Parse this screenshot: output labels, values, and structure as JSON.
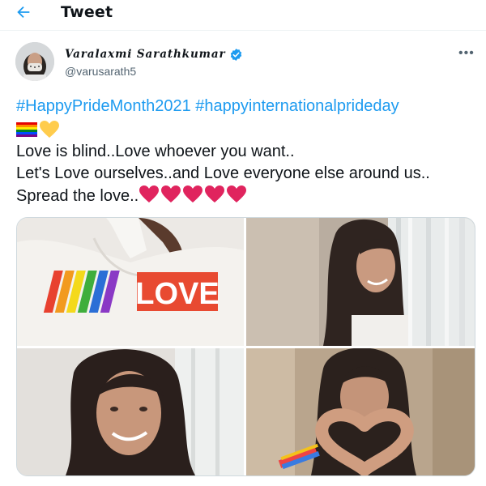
{
  "header": {
    "title": "Tweet"
  },
  "author": {
    "display_name": "Varalaxmi Sarathkumar",
    "handle": "@varusarath5"
  },
  "tweet": {
    "hashtags": [
      "#HappyPrideMonth2021",
      "#happyinternationalprideday"
    ],
    "emojis": [
      "rainbow-flag",
      "yellow-heart"
    ],
    "lines": [
      "Love is blind..Love whoever you want..",
      "Let's Love ourselves..and Love everyone else around us..",
      "Spread the love.."
    ],
    "hearts_count": 5
  },
  "media": {
    "sweatshirt_text": "LOVE",
    "photos": [
      "love-sweatshirt-photo",
      "window-smile-photo",
      "selfie-smile-photo",
      "heart-hands-photo"
    ]
  },
  "colors": {
    "accent": "#1d9bf0",
    "heart": "#e0245e",
    "text": "#0f1419",
    "muted": "#536471"
  }
}
